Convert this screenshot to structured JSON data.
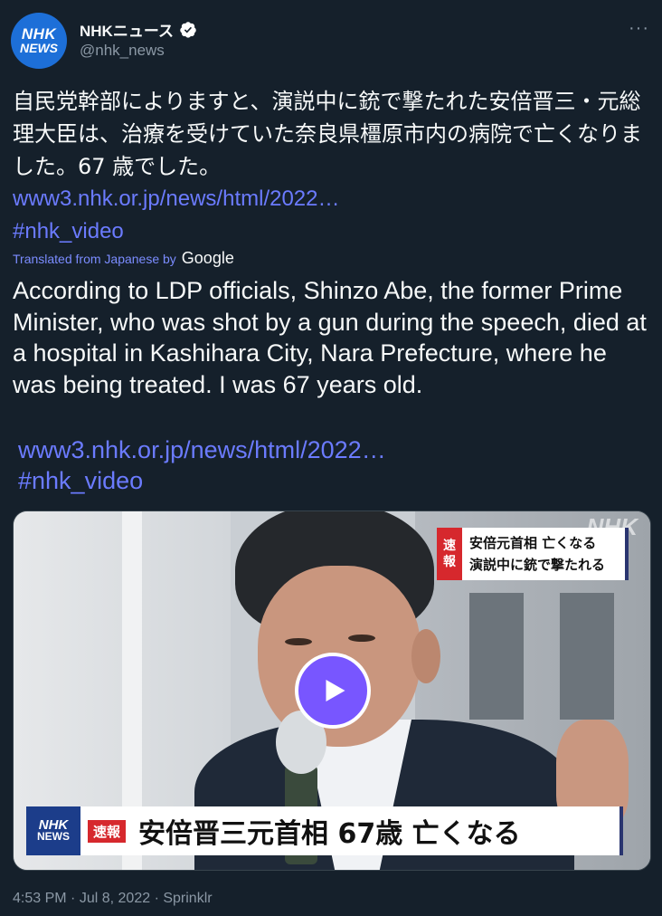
{
  "author": {
    "display_name": "NHKニュース",
    "handle": "@nhk_news",
    "avatar_line1": "NHK",
    "avatar_line2": "NEWS",
    "verified_icon": "verified-badge-icon"
  },
  "menu": {
    "more_label": "···"
  },
  "tweet": {
    "japanese_text": "自民党幹部によりますと、演説中に銃で撃たれた安倍晋三・元総理大臣は、治療を受けていた奈良県橿原市内の病院で亡くなりました。67 歳でした。",
    "japanese_link": "www3.nhk.or.jp/news/html/2022…",
    "japanese_hashtag": "#nhk_video",
    "translated_label": "Translated from Japanese by",
    "translator": "Google",
    "english_text": "According to LDP officials, Shinzo Abe, the former Prime Minister, who was shot by a gun during the speech, died at a hospital in Kashihara City, Nara Prefecture, where he was being treated. I was 67 years old.",
    "english_link": "www3.nhk.or.jp/news/html/2022…",
    "english_hashtag": "#nhk_video"
  },
  "media": {
    "watermark": "NHK",
    "top_banner_tag": "速報",
    "top_banner_line1": "安倍元首相 亡くなる",
    "top_banner_line2": "演説中に銃で撃たれる",
    "bottom_nhk_line1": "NHK",
    "bottom_nhk_line2": "NEWS",
    "bottom_banner_tag": "速報",
    "bottom_headline": "安倍晋三元首相 67歳 亡くなる",
    "play_icon": "play-icon"
  },
  "footer": {
    "time": "4:53 PM",
    "date": "Jul 8, 2022",
    "source": "Sprinklr",
    "separator": "·"
  },
  "colors": {
    "background": "#15202b",
    "link": "#6b7bff",
    "play_button": "#7856ff",
    "breaking_red": "#d6282d"
  }
}
